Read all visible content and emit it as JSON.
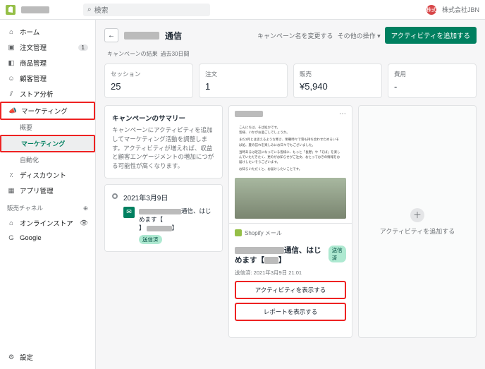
{
  "topbar": {
    "search_placeholder": "検索",
    "avatar_text": "株式",
    "company": "株式会社JBN"
  },
  "sidebar": {
    "items": [
      {
        "label": "ホーム"
      },
      {
        "label": "注文管理",
        "badge": "1"
      },
      {
        "label": "商品管理"
      },
      {
        "label": "顧客管理"
      },
      {
        "label": "ストア分析"
      },
      {
        "label": "マーケティング"
      },
      {
        "label": "概要"
      },
      {
        "label": "マーケティング"
      },
      {
        "label": "自動化"
      },
      {
        "label": "ディスカウント"
      },
      {
        "label": "アプリ管理"
      }
    ],
    "channels_label": "販売チャネル",
    "channels": [
      {
        "label": "オンラインストア"
      },
      {
        "label": "Google"
      }
    ],
    "settings": "設定"
  },
  "page": {
    "title_suffix": "通信",
    "rename": "キャンペーン名を変更する",
    "other": "その他の操作",
    "add": "アクティビティを追加する",
    "results_title": "キャンペーンの結果",
    "results_period": "過去30日間"
  },
  "stats": [
    {
      "label": "セッション",
      "value": "25"
    },
    {
      "label": "注文",
      "value": "1"
    },
    {
      "label": "販売",
      "value": "¥5,940"
    },
    {
      "label": "費用",
      "value": "-"
    }
  ],
  "summary": {
    "title": "キャンペーンのサマリー",
    "body": "キャンペーンにアクティビティを追加してマーケティング活動を調整します。アクティビティが増えれば、収益と顧客エンゲージメントの増加につがる可能性が高くなります。"
  },
  "timeline": {
    "date": "2021年3月9日",
    "item_suffix": "通信、はじめます【",
    "item_brace": "】",
    "sent_tag": "送信済"
  },
  "preview": {
    "greeting1": "こんにちは、そば処かです。",
    "greeting2": "皆様、いかがお過ごしでしょうか。",
    "body1": "まだ3月とは思えるような寒さ、明朝時々で雪も持ち合わせためるいそば処、夏の訪れを楽しみにお日々でもございました。",
    "body2": "当時あるは近辺になっている皆様に、もっと「長野」や「そば」を楽しんでいただきたく、更のがお知らせがご注文、おとっておきの情報をお届けしたいそうございます。",
    "body3": "お知らいただくと、お届けしたいことです。",
    "source": "Shopify メール",
    "meta_title_mid": "通信、はじめます【",
    "meta_title_end": "】",
    "sent_tag": "送信済",
    "sent_time": "送信済: 2021年3月9日 21:01",
    "btn_activity": "アクティビティを表示する",
    "btn_report": "レポートを表示する"
  },
  "add_activity": "アクティビティを追加する"
}
